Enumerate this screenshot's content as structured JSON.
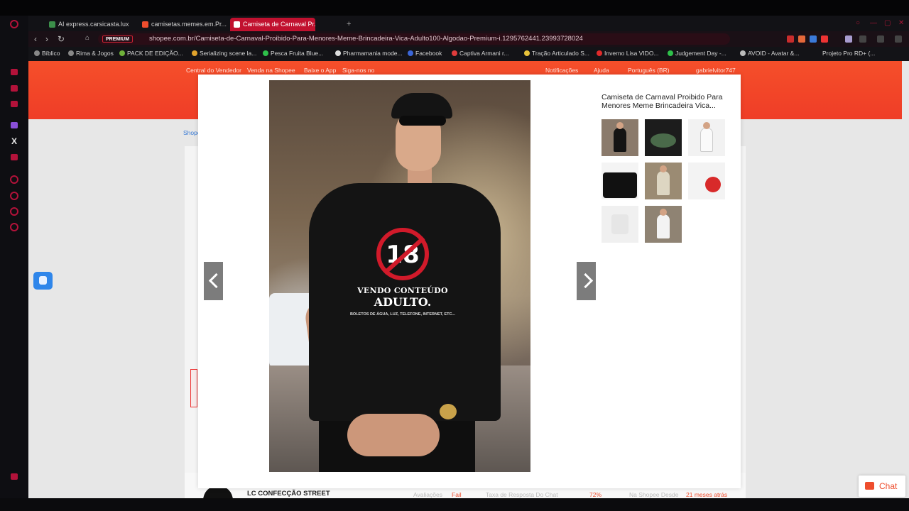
{
  "browser": {
    "tabs": [
      {
        "label": "AI express.carsicasta.lux",
        "active": false,
        "favicon_color": "#3b8f4a"
      },
      {
        "label": "camisetas.memes.em.Pr...",
        "active": false,
        "favicon_color": "#ee4d2d"
      },
      {
        "label": "Camiseta de Carnaval Pr...",
        "active": true,
        "favicon_color": "#ee4d2d"
      }
    ],
    "new_tab_label": "+",
    "url_badge": "PREMIUM",
    "url": "shopee.com.br/Camiseta-de-Carnaval-Proibido-Para-Menores-Meme-Brincadeira-Vica-Adulto100-Algodao-Premium-i.1295762441.23993728024",
    "bookmarks": [
      "Bíblico",
      "Rima & Jogos",
      "PACK DE EDIÇÃO...",
      "Serializing scene la...",
      "Pesca Fruita Blue...",
      "Pharmamania mode...",
      "Facebook",
      "Captiva Armani r...",
      "Tração Articulado S...",
      "Inverno Lisa VIDO...",
      "Judgement Day -...",
      "AVOID - Avatar &...",
      "Projeto Pro RD+ (..."
    ]
  },
  "page": {
    "header_links": [
      "Central do Vendedor",
      "Venda na Shopee",
      "Baixe o App",
      "Siga-nos no"
    ],
    "header_right": [
      "Notificações",
      "Ajuda",
      "Português (BR)",
      "gabrielvitor747"
    ],
    "breadcrumb": "Shopee",
    "seller_name": "LC CONFECÇÃO STREET",
    "seller_stats": [
      {
        "label": "Avaliações",
        "value": "Fail"
      },
      {
        "label": "Taxa de Resposta Do Chat",
        "value": "72%"
      },
      {
        "label": "Na Shopee Desde",
        "value": "21 meses atrás"
      }
    ]
  },
  "modal": {
    "product_title": "Camiseta de Carnaval Proibido Para Menores Meme Brincadeira Vica...",
    "shirt_print": {
      "number": "18",
      "line1": "VENDO CONTEÚDO",
      "line2": "ADULTO.",
      "line3": "BOLETOS DE ÁGUA, LUZ, TELEFONE, INTERNET, ETC..."
    },
    "thumbnails": [
      {
        "name": "thumb-1",
        "selected": true
      },
      {
        "name": "thumb-2",
        "selected": false
      },
      {
        "name": "thumb-3",
        "selected": false
      },
      {
        "name": "thumb-4",
        "selected": false
      },
      {
        "name": "thumb-5",
        "selected": false
      },
      {
        "name": "thumb-6",
        "selected": false
      },
      {
        "name": "thumb-7",
        "selected": false
      },
      {
        "name": "thumb-8",
        "selected": false
      }
    ]
  },
  "chat": {
    "label": "Chat",
    "icon": "chat-bubble-icon"
  },
  "colors": {
    "brand": "#ee4d2d",
    "browser_accent": "#c1112f"
  }
}
